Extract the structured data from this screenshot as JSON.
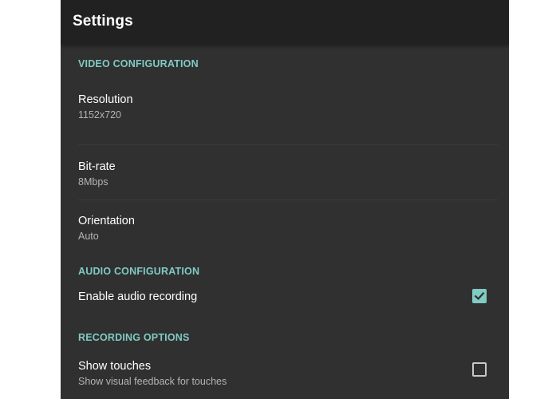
{
  "app_bar": {
    "title": "Settings"
  },
  "sections": {
    "video": {
      "header": "VIDEO CONFIGURATION",
      "resolution": {
        "title": "Resolution",
        "summary": "1152x720"
      },
      "bitrate": {
        "title": "Bit-rate",
        "summary": "8Mbps"
      },
      "orientation": {
        "title": "Orientation",
        "summary": "Auto"
      }
    },
    "audio": {
      "header": "AUDIO CONFIGURATION",
      "enable_audio": {
        "title": "Enable audio recording",
        "checked": true
      }
    },
    "recording": {
      "header": "RECORDING OPTIONS",
      "show_touches": {
        "title": "Show touches",
        "summary": "Show visual feedback for touches",
        "checked": false
      }
    }
  },
  "colors": {
    "accent": "#80cbc4",
    "background": "#303030",
    "app_bar": "#212121"
  }
}
